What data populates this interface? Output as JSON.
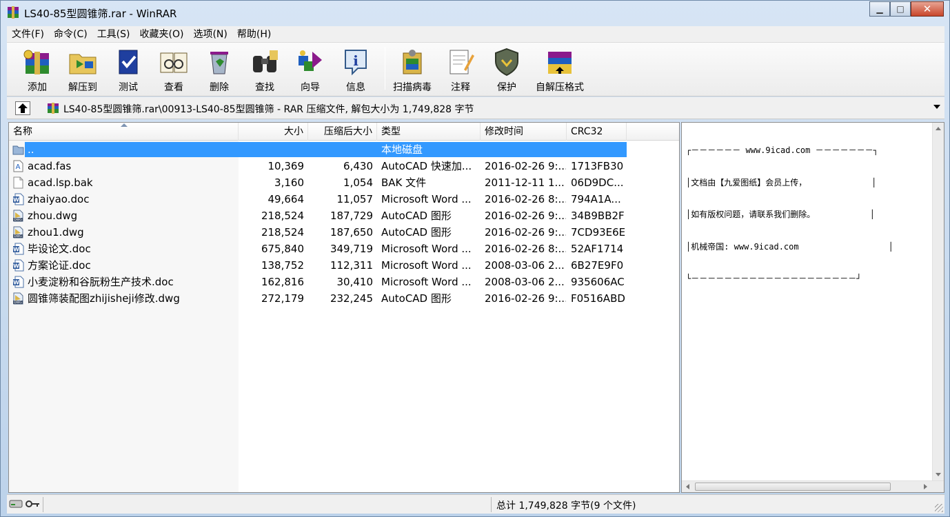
{
  "window": {
    "title": "LS40-85型圆锥筛.rar - WinRAR",
    "minimize_glyph": "▁",
    "maximize_glyph": "□",
    "close_glyph": "✕"
  },
  "menu": [
    "文件(F)",
    "命令(C)",
    "工具(S)",
    "收藏夹(O)",
    "选项(N)",
    "帮助(H)"
  ],
  "toolbar": {
    "add": "添加",
    "extract": "解压到",
    "test": "测试",
    "view": "查看",
    "delete": "删除",
    "find": "查找",
    "wizard": "向导",
    "info": "信息",
    "virus_scan": "扫描病毒",
    "comment": "注释",
    "protect": "保护",
    "sfx": "自解压格式"
  },
  "address": {
    "path": "LS40-85型圆锥筛.rar\\00913-LS40-85型圆锥筛 - RAR 压缩文件, 解包大小为 1,749,828 字节"
  },
  "columns": {
    "name": "名称",
    "size": "大小",
    "packed": "压缩后大小",
    "type": "类型",
    "modified": "修改时间",
    "crc": "CRC32"
  },
  "files": [
    {
      "name": "..",
      "size": "",
      "packed": "",
      "type": "本地磁盘",
      "modified": "",
      "crc": "",
      "icon": "folder-up-icon"
    },
    {
      "name": "acad.fas",
      "size": "10,369",
      "packed": "6,430",
      "type": "AutoCAD 快速加...",
      "modified": "2016-02-26 9:...",
      "crc": "1713FB30",
      "icon": "fas-file-icon"
    },
    {
      "name": "acad.lsp.bak",
      "size": "3,160",
      "packed": "1,054",
      "type": "BAK 文件",
      "modified": "2011-12-11 1...",
      "crc": "06D9DC...",
      "icon": "blank-file-icon"
    },
    {
      "name": "zhaiyao.doc",
      "size": "49,664",
      "packed": "11,057",
      "type": "Microsoft Word ...",
      "modified": "2016-02-26 8:...",
      "crc": "794A1A...",
      "icon": "word-doc-icon"
    },
    {
      "name": "zhou.dwg",
      "size": "218,524",
      "packed": "187,729",
      "type": "AutoCAD 图形",
      "modified": "2016-02-26 9:...",
      "crc": "34B9BB2F",
      "icon": "dwg-file-icon"
    },
    {
      "name": "zhou1.dwg",
      "size": "218,524",
      "packed": "187,650",
      "type": "AutoCAD 图形",
      "modified": "2016-02-26 9:...",
      "crc": "7CD93E6E",
      "icon": "dwg-file-icon"
    },
    {
      "name": "毕设论文.doc",
      "size": "675,840",
      "packed": "349,719",
      "type": "Microsoft Word ...",
      "modified": "2016-02-26 8:...",
      "crc": "52AF1714",
      "icon": "word-doc-icon"
    },
    {
      "name": "方案论证.doc",
      "size": "138,752",
      "packed": "112,311",
      "type": "Microsoft Word ...",
      "modified": "2008-03-06 2...",
      "crc": "6B27E9F0",
      "icon": "word-doc-icon"
    },
    {
      "name": "小麦淀粉和谷朊粉生产技术.doc",
      "size": "162,816",
      "packed": "30,410",
      "type": "Microsoft Word ...",
      "modified": "2008-03-06 2...",
      "crc": "935606AC",
      "icon": "word-doc-icon"
    },
    {
      "name": "圆锥筛装配图zhijisheji修改.dwg",
      "size": "272,179",
      "packed": "232,245",
      "type": "AutoCAD 图形",
      "modified": "2016-02-26 9:...",
      "crc": "F0516ABD",
      "icon": "dwg-file-icon"
    }
  ],
  "comment": {
    "lines": [
      "┌－－－－－－ www.9icad.com －－－－－－－┐",
      "│文档由【九爱图纸】会员上传，             │",
      "│如有版权问题，请联系我们删除。           │",
      "│机械帝国: www.9icad.com                  │",
      "└－－－－－－－－－－－－－－－－－－－－┘"
    ]
  },
  "status": {
    "total": "总计 1,749,828 字节(9 个文件)"
  },
  "colors": {
    "selection": "#3399ff",
    "title_gradient_top": "#d7e5f5",
    "close_button": "#c8462b"
  }
}
